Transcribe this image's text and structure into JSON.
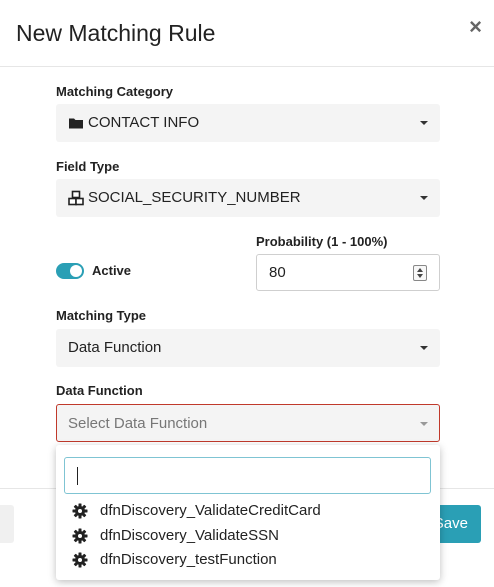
{
  "modal": {
    "title": "New Matching Rule",
    "close": "×"
  },
  "matching_category": {
    "label": "Matching Category",
    "value": "CONTACT INFO",
    "icon": "folder-icon"
  },
  "field_type": {
    "label": "Field Type",
    "value": "SOCIAL_SECURITY_NUMBER",
    "icon": "cubes-icon"
  },
  "active": {
    "label": "Active",
    "enabled": true
  },
  "probability": {
    "label": "Probability (1 - 100%)",
    "value": "80"
  },
  "matching_type": {
    "label": "Matching Type",
    "value": "Data Function"
  },
  "data_function": {
    "label": "Data Function",
    "placeholder": "Select Data Function",
    "search_value": "",
    "options": [
      "dfnDiscovery_ValidateCreditCard",
      "dfnDiscovery_ValidateSSN",
      "dfnDiscovery_testFunction"
    ]
  },
  "footer": {
    "save_label": "Save"
  },
  "colors": {
    "accent": "#2a9fb5",
    "error_border": "#c0392b"
  }
}
